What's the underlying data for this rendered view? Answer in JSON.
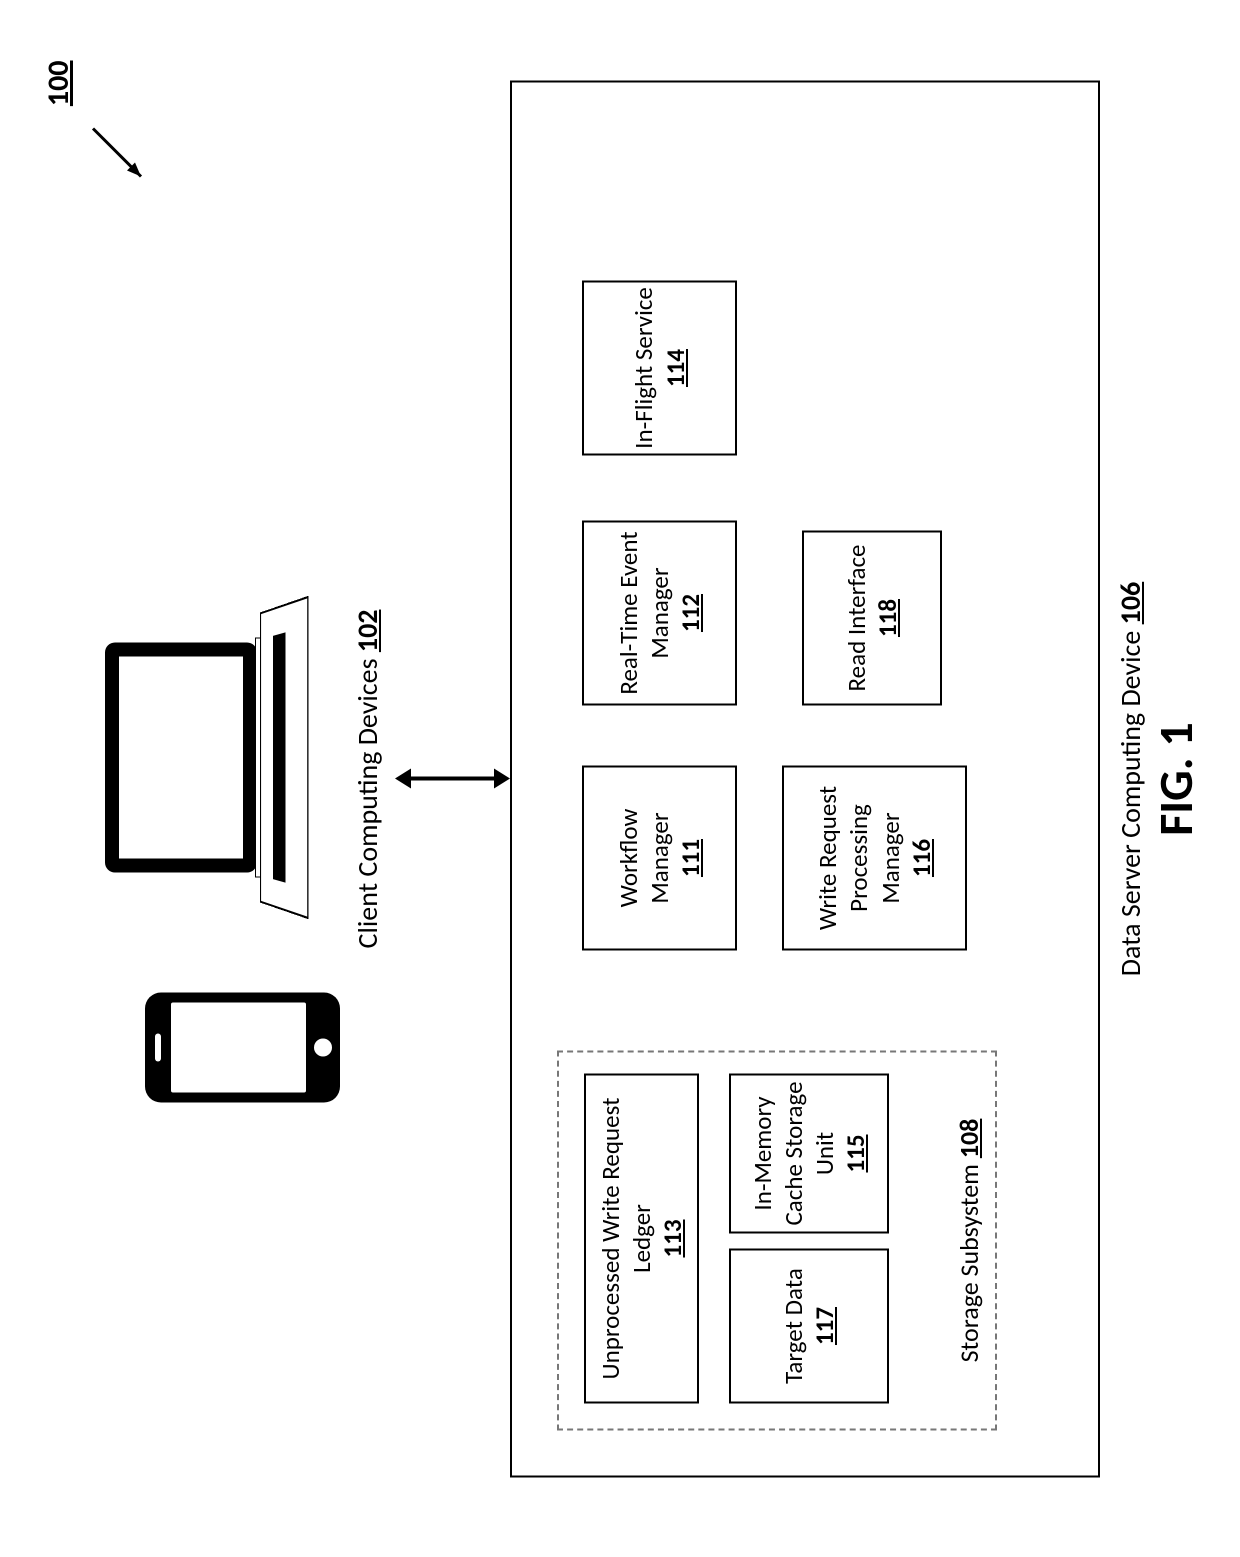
{
  "figure_ref": "100",
  "client": {
    "label": "Client Computing Devices",
    "ref": "102"
  },
  "server": {
    "label": "Data Server Computing Device",
    "ref": "106"
  },
  "storage": {
    "label": "Storage Subsystem",
    "ref": "108"
  },
  "components": {
    "c111": {
      "label": "Workflow Manager",
      "ref": "111"
    },
    "c112": {
      "label": "Real-Time Event Manager",
      "ref": "112"
    },
    "c113": {
      "label": "Unprocessed Write Request Ledger",
      "ref": "113"
    },
    "c114": {
      "label": "In-Flight Service",
      "ref": "114"
    },
    "c115": {
      "label": "In-Memory Cache Storage Unit",
      "ref": "115"
    },
    "c116": {
      "label": "Write Request Processing Manager",
      "ref": "116"
    },
    "c117": {
      "label": "Target Data",
      "ref": "117"
    },
    "c118": {
      "label": "Read Interface",
      "ref": "118"
    }
  },
  "figure_label": "FIG. 1"
}
